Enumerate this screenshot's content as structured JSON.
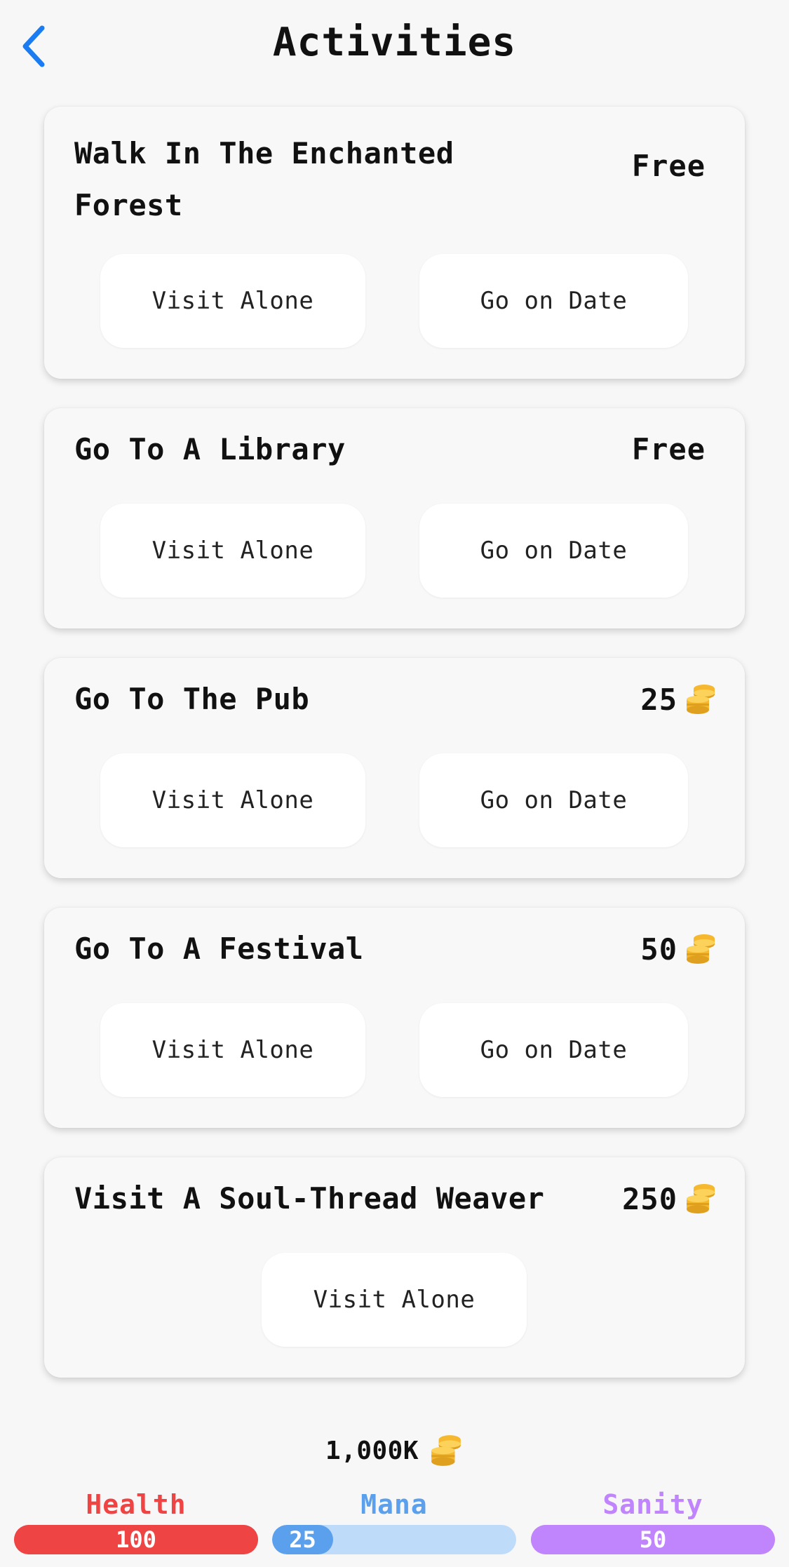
{
  "header": {
    "title": "Activities",
    "back_icon": "chevron-left-icon",
    "back_color": "#1a7cf0"
  },
  "activities": [
    {
      "title": "Walk In The Enchanted Forest",
      "price": "Free",
      "price_icon": null,
      "buttons": [
        "Visit Alone",
        "Go on Date"
      ]
    },
    {
      "title": "Go To A Library",
      "price": "Free",
      "price_icon": null,
      "buttons": [
        "Visit Alone",
        "Go on Date"
      ]
    },
    {
      "title": "Go To The Pub",
      "price": "25",
      "price_icon": "coin-stack-icon",
      "buttons": [
        "Visit Alone",
        "Go on Date"
      ]
    },
    {
      "title": "Go To A Festival",
      "price": "50",
      "price_icon": "coin-stack-icon",
      "buttons": [
        "Visit Alone",
        "Go on Date"
      ]
    },
    {
      "title": "Visit A Soul-Thread Weaver",
      "price": "250",
      "price_icon": "coin-stack-icon",
      "buttons": [
        "Visit Alone"
      ]
    }
  ],
  "money": {
    "amount": "1,000K",
    "icon": "coin-stack-icon"
  },
  "stats": [
    {
      "label": "Health",
      "value": "100",
      "fraction": 1.0,
      "color": "#ef4444",
      "track": "#ef4444"
    },
    {
      "label": "Mana",
      "value": "25",
      "fraction": 0.25,
      "color": "#5aa0ec",
      "track": "#bfdbfa"
    },
    {
      "label": "Sanity",
      "value": "50",
      "fraction": 1.0,
      "color": "#c084fc",
      "track": "#c084fc"
    }
  ],
  "colors": {
    "coin_gold": "#f5b82e",
    "background": "#f7f7f7"
  }
}
